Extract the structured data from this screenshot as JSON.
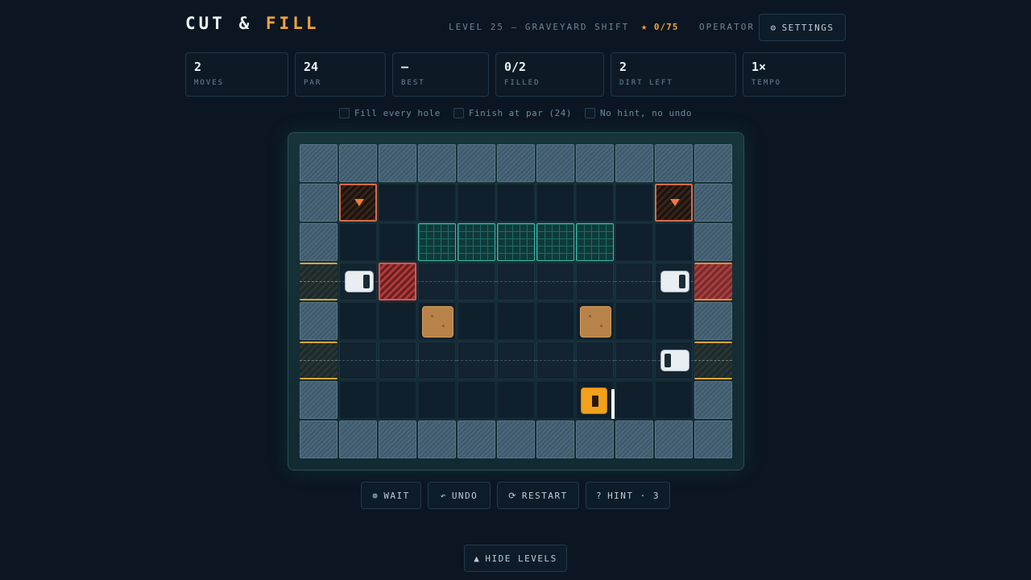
{
  "header": {
    "logo_part1": "CUT",
    "logo_amp": "&",
    "logo_part2": "FILL",
    "level_title": "LEVEL 25 — GRAVEYARD SHIFT",
    "stars": "0/75",
    "star_icon": "★",
    "operator_label": "OPERATOR",
    "settings_icon": "⚙",
    "settings_label": "SETTINGS"
  },
  "stats": [
    {
      "value": "2",
      "label": "MOVES"
    },
    {
      "value": "24",
      "label": "PAR"
    },
    {
      "value": "—",
      "label": "BEST"
    },
    {
      "value": "0/2",
      "label": "FILLED"
    },
    {
      "value": "2",
      "label": "DIRT LEFT"
    },
    {
      "value": "1×",
      "label": "TEMPO"
    }
  ],
  "objectives": [
    {
      "label": "Fill every hole",
      "checked": false
    },
    {
      "label": "Finish at par (24)",
      "checked": false
    },
    {
      "label": "No hint, no undo",
      "checked": false
    }
  ],
  "controls": {
    "wait_icon": "⊚",
    "wait_label": "WAIT",
    "undo_icon": "↶",
    "undo_label": "UNDO",
    "restart_icon": "⟳",
    "restart_label": "RESTART",
    "hint_icon": "?",
    "hint_label": "HINT · 3",
    "levels_icon": "▲",
    "levels_label": "HIDE LEVELS"
  },
  "board": {
    "legend": "W=wall .=floor -=lane G=gate R=hot gate H=hole P=pad X=hazard",
    "rows": [
      "WWWWWWWWWWW",
      "WH.......HW",
      "W..PPPPP..W",
      "G-X------ R",
      "W.........W",
      "G---------G",
      "W.........W",
      "WWWWWWWWWWW"
    ],
    "dirt": [
      [
        4,
        3
      ],
      [
        4,
        7
      ]
    ],
    "cars": [
      {
        "row": 3,
        "col": 1,
        "facing": "right"
      },
      {
        "row": 3,
        "col": 9,
        "facing": "right"
      },
      {
        "row": 5,
        "col": 9,
        "facing": "left"
      }
    ],
    "dozer": {
      "row": 6,
      "col": 7,
      "facing": "right"
    }
  }
}
